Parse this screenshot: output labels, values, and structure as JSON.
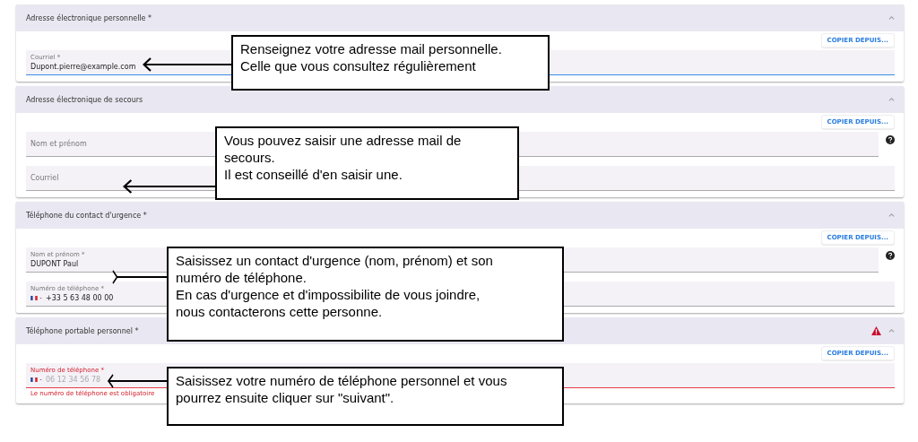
{
  "sections": [
    {
      "title": "Adresse électronique personnelle *",
      "expanded": true,
      "warning": false,
      "copy_button": "COPIER DEPUIS...",
      "fields": [
        {
          "kind": "text",
          "label": "Courriel *",
          "value": "Dupont.pierre@example.com",
          "focused": true,
          "error": false,
          "help": false
        }
      ]
    },
    {
      "title": "Adresse électronique de secours",
      "expanded": true,
      "warning": false,
      "copy_button": "COPIER DEPUIS...",
      "fields": [
        {
          "kind": "text",
          "placeholder": "Nom et prénom",
          "focused": false,
          "error": false,
          "help": true
        },
        {
          "kind": "text",
          "placeholder": "Courriel",
          "focused": false,
          "error": false,
          "help": false
        }
      ]
    },
    {
      "title": "Téléphone du contact d'urgence *",
      "expanded": true,
      "warning": false,
      "copy_button": "COPIER DEPUIS...",
      "fields": [
        {
          "kind": "text",
          "label": "Nom et prénom *",
          "value": "DUPONT Paul",
          "focused": false,
          "error": false,
          "help": true
        },
        {
          "kind": "phone",
          "label": "Numéro de téléphone *",
          "value": "+33 5 63 48 00 00",
          "focused": false,
          "error": false,
          "help": false
        }
      ]
    },
    {
      "title": "Téléphone portable personnel *",
      "expanded": true,
      "warning": true,
      "copy_button": "COPIER DEPUIS...",
      "fields": [
        {
          "kind": "phone",
          "label": "Numéro de téléphone *",
          "placeholder": "06 12 34 56 78",
          "focused": false,
          "error": true,
          "help": false,
          "error_message": "Le numéro de téléphone est obligatoire"
        }
      ]
    }
  ],
  "callouts": [
    {
      "points_right": false,
      "lines": [
        "Renseignez votre adresse mail personnelle.",
        "Celle que vous consultez régulièrement"
      ]
    },
    {
      "points_right": false,
      "lines": [
        "Vous pouvez saisir une adresse mail de",
        "secours.",
        "Il est conseillé d'en saisir une."
      ]
    },
    {
      "points_right": true,
      "lines": [
        "Saisissez un contact d'urgence (nom, prénom) et son",
        "numéro de téléphone.",
        "En cas d'urgence et d'impossibilite de vous joindre,",
        "nous contacterons cette personne."
      ]
    },
    {
      "points_right": false,
      "lines": [
        "Saisissez votre numéro de téléphone personnel et vous",
        "pourrez ensuite cliquer sur \"suivant\"."
      ]
    }
  ]
}
